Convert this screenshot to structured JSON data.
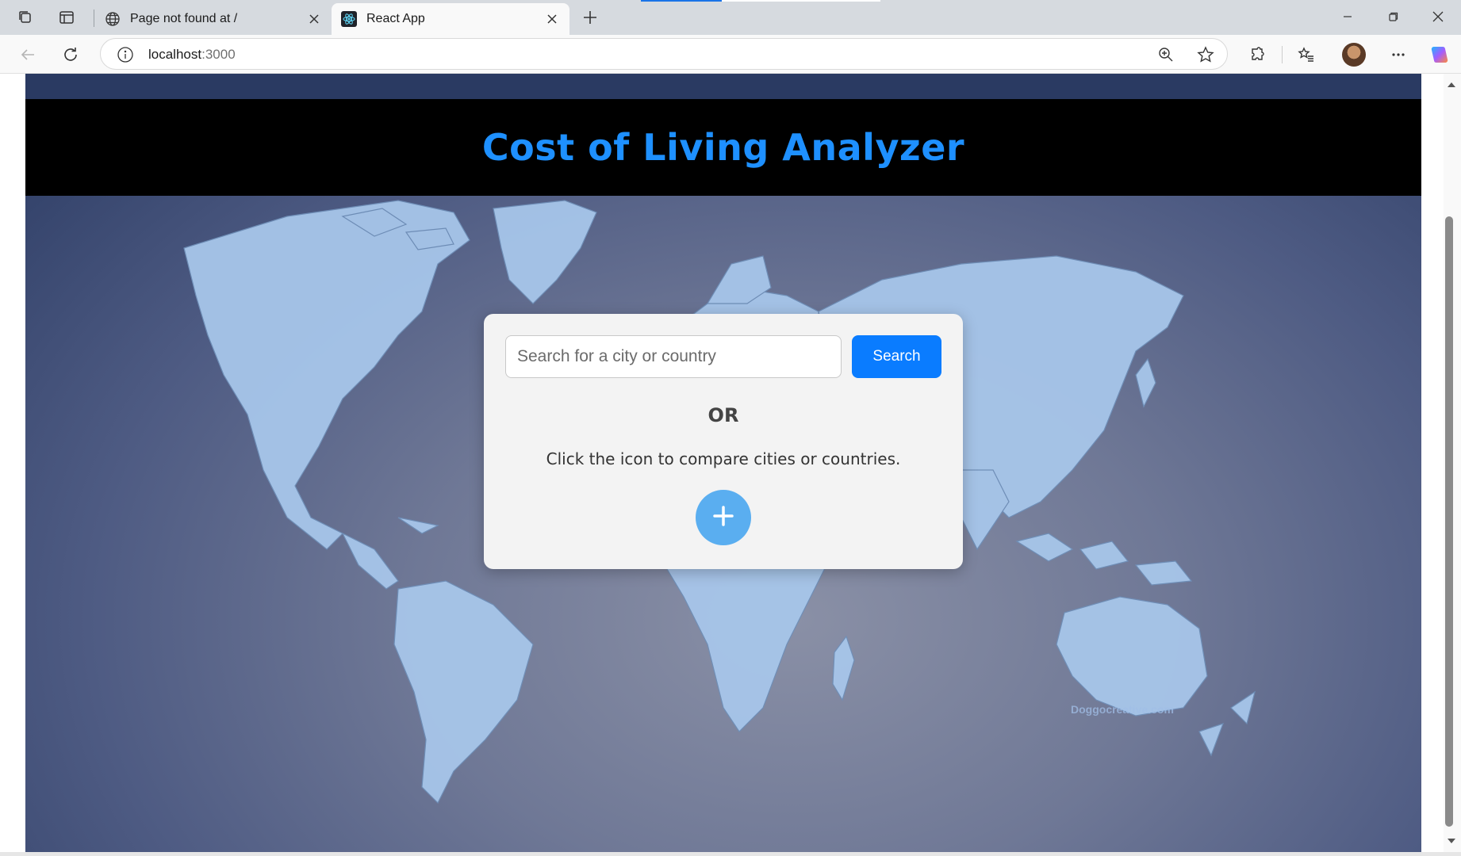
{
  "browser": {
    "tabs": [
      {
        "title": "Page not found at /",
        "favicon": "globe-icon",
        "active": false
      },
      {
        "title": "React App",
        "favicon": "react-icon",
        "active": true
      }
    ],
    "address": {
      "host": "localhost",
      "port": ":3000"
    }
  },
  "app": {
    "title": "Cost of Living Analyzer",
    "search": {
      "placeholder": "Search for a city or country",
      "button_label": "Search"
    },
    "or_label": "OR",
    "compare_instruction": "Click the icon to compare cities or countries.",
    "compare_icon": "plus-icon"
  },
  "map": {
    "watermark": "Doggocreative.com"
  },
  "colors": {
    "accent": "#0a7cff",
    "title": "#1e90ff",
    "plus_button": "#5aaef0"
  }
}
